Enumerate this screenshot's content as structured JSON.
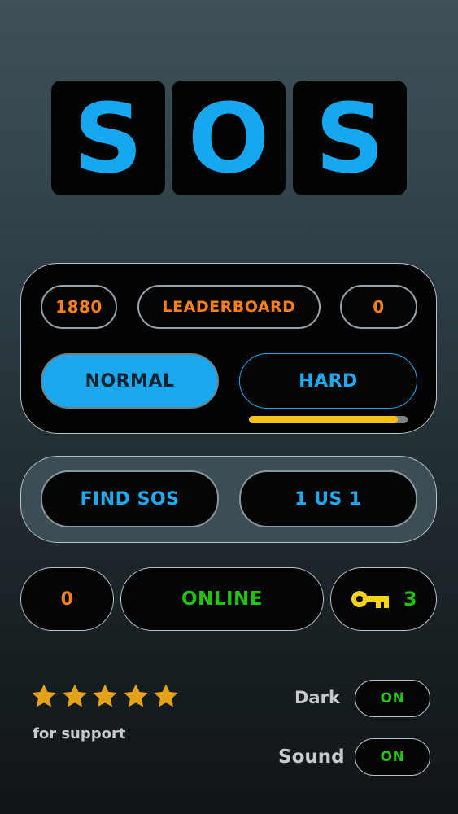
{
  "title_tiles": [
    "S",
    "O",
    "S"
  ],
  "stats": {
    "score": "1880",
    "leaderboard_label": "LEADERBOARD",
    "rank": "0"
  },
  "difficulty": {
    "normal_label": "NORMAL",
    "hard_label": "HARD",
    "hard_progress": 0.94
  },
  "modes": {
    "find_label": "FIND SOS",
    "versus_label": "1 US 1"
  },
  "online_row": {
    "count": "0",
    "online_label": "ONLINE",
    "keys": "3"
  },
  "rating": {
    "stars": 5,
    "support_label": "for support"
  },
  "settings": {
    "dark_label": "Dark",
    "dark_value": "ON",
    "sound_label": "Sound",
    "sound_value": "ON"
  },
  "colors": {
    "accent_blue": "#16a7ee",
    "accent_orange": "#f7801d",
    "accent_green": "#22c30f",
    "star_gold": "#e4a21a",
    "key_yellow": "#f5d21a"
  },
  "icons": [
    "star-icon",
    "key-icon"
  ]
}
